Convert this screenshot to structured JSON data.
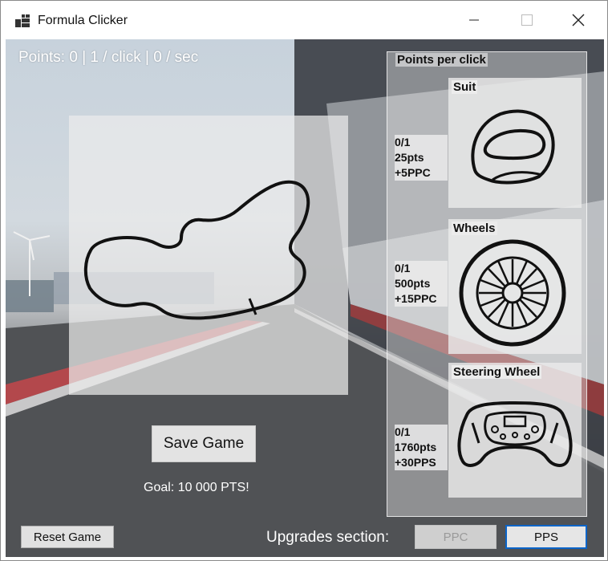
{
  "window": {
    "title": "Formula Clicker",
    "controls": {
      "minimize": "minimize-icon",
      "maximize": "maximize-icon",
      "close": "close-icon"
    }
  },
  "stats": {
    "text": "Points: 0 | 1 / click  | 0 / sec"
  },
  "actions": {
    "save_label": "Save Game",
    "goal_text": "Goal: 10 000 PTS!",
    "reset_label": "Reset Game"
  },
  "upgrades": {
    "section_label": "Upgrades section:",
    "tab_ppc": "PPC",
    "tab_pps": "PPS",
    "active_tab": "PPS",
    "panel_title": "Points per click",
    "items": [
      {
        "name": "Suit",
        "owned": "0/1",
        "cost": "25pts",
        "bonus": "+5PPC",
        "icon": "helmet-icon"
      },
      {
        "name": "Wheels",
        "owned": "0/1",
        "cost": "500pts",
        "bonus": "+15PPC",
        "icon": "wheel-icon"
      },
      {
        "name": "Steering Wheel",
        "owned": "0/1",
        "cost": "1760pts",
        "bonus": "+30PPS",
        "icon": "steering-wheel-icon"
      }
    ]
  },
  "colors": {
    "active_tab_border": "#0a64c8",
    "overlay_text": "#ffffff"
  }
}
